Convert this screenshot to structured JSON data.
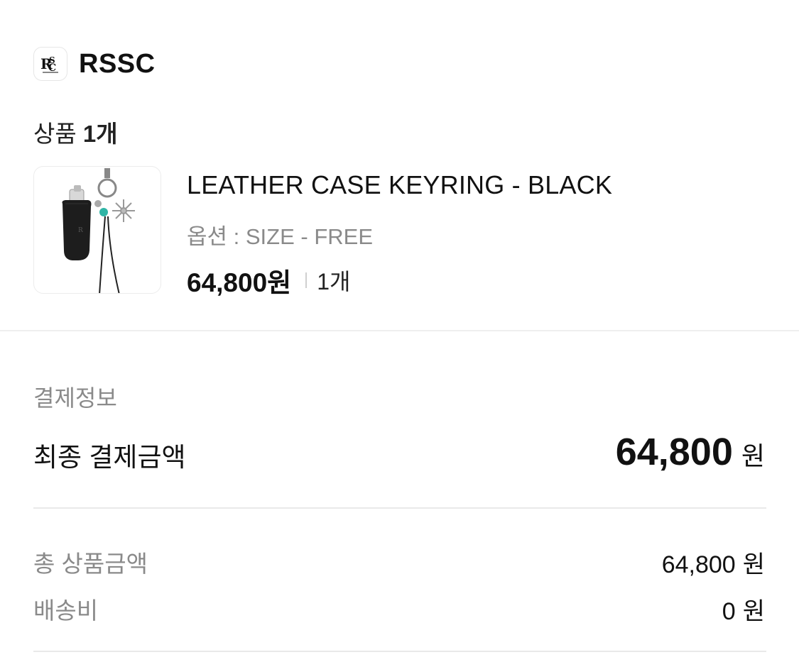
{
  "brand": {
    "logo_text": "RSSC",
    "name": "RSSC"
  },
  "product_section": {
    "count_label": "상품",
    "count_value": "1개"
  },
  "product": {
    "name": "LEATHER CASE KEYRING - BLACK",
    "option": "옵션 : SIZE - FREE",
    "price": "64,800원",
    "quantity": "1개",
    "thumbnail_icon": "keyring-product-photo"
  },
  "payment": {
    "title": "결제정보",
    "final_label": "최종 결제금액",
    "final_value": "64,800",
    "final_unit": "원",
    "rows": [
      {
        "label": "총 상품금액",
        "value": "64,800",
        "unit": "원"
      },
      {
        "label": "배송비",
        "value": "0",
        "unit": "원"
      }
    ]
  }
}
